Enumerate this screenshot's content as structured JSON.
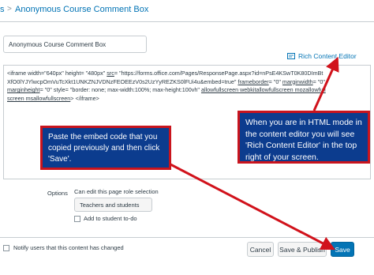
{
  "breadcrumb": {
    "prev": "s",
    "separator": ">",
    "current": "Anonymous Course Comment Box"
  },
  "title_input": {
    "value": "Anonymous Course Comment Box"
  },
  "rce_link": {
    "label": "Rich Content Editor",
    "icon": "rich-content-editor-icon"
  },
  "editor": {
    "seg1": "<iframe width=\"640px\" height= \"480px\" ",
    "seg2": "src",
    "seg3": "= \"https://forms.office.com/Pages/ResponsePage.aspx?id=nPsE4KSwT0K80DImBtXfO0lYJYlwcpOmVuTcXkt1UNKZNJVDNzFEOEEzV0s2UzYyREZKS0lFUi4u&embed=true\" ",
    "seg4": "frameborder",
    "seg5": "= \"0\" ",
    "seg6": "marginwidth",
    "seg7": "= \"0\" ",
    "seg8": "marginheight",
    "seg9": "= \"0\" style= \"border: none; max-width:100%; max-height:100vh\" ",
    "seg10": "allowfullscreen webkitallowfullscreen mozallowfullscreen msallowfullscreen",
    "seg11": "> </iframe>"
  },
  "callouts": {
    "left": "Paste the embed code that you copied previously and then click 'Save'.",
    "right": "When you are in HTML mode in the content editor you will see 'Rich Content Editor' in the top right of your screen."
  },
  "options": {
    "label": "Options",
    "permission_label": "Can edit this page role selection",
    "permission_value": "Teachers and students",
    "todo_label": "Add to student to-do"
  },
  "footer": {
    "notify_label": "Notify users that this content has changed",
    "cancel": "Cancel",
    "save_publish": "Save & Publish",
    "save": "Save"
  },
  "colors": {
    "link": "#0374b5",
    "callout_bg": "#0c3c8e",
    "callout_border": "#c9141d",
    "arrow": "#d1121b",
    "primary_button": "#0374b5"
  }
}
